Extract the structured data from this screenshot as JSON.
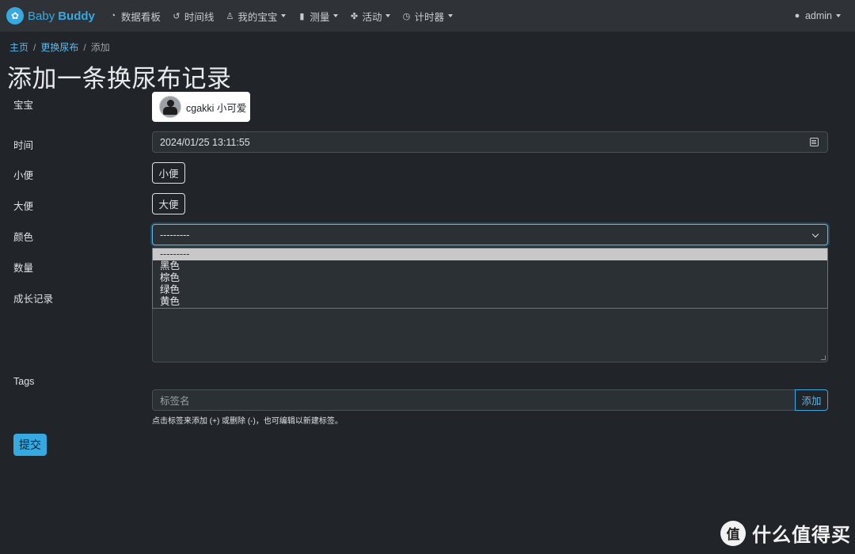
{
  "navbar": {
    "brand_prefix": "Baby",
    "brand_suffix": "Buddy",
    "items": [
      {
        "label": "数据看板",
        "icon": "dashboard-icon",
        "dropdown": false
      },
      {
        "label": "时间线",
        "icon": "history-icon",
        "dropdown": false
      },
      {
        "label": "我的宝宝",
        "icon": "baby-icon",
        "dropdown": true
      },
      {
        "label": "测量",
        "icon": "clipboard-icon",
        "dropdown": true
      },
      {
        "label": "活动",
        "icon": "activities-icon",
        "dropdown": true
      },
      {
        "label": "计时器",
        "icon": "timer-icon",
        "dropdown": true
      }
    ],
    "user": "admin"
  },
  "breadcrumb": {
    "home": "主页",
    "section": "更换尿布",
    "current": "添加"
  },
  "page_title": "添加一条换尿布记录",
  "form": {
    "child_label": "宝宝",
    "child_name": "cgakki 小可爱",
    "time_label": "时间",
    "time_value": "2024/01/25 13:11:55",
    "wet_label": "小便",
    "wet_button": "小便",
    "solid_label": "大便",
    "solid_button": "大便",
    "color_label": "颜色",
    "color_selected": "---------",
    "color_options": [
      "---------",
      "黑色",
      "棕色",
      "绿色",
      "黄色"
    ],
    "amount_label": "数量",
    "notes_label": "成长记录",
    "tags_label": "Tags",
    "tags_placeholder": "标签名",
    "tags_add": "添加",
    "tags_help": "点击标签来添加 (+) 或删除 (-)，也可编辑以新建标签。",
    "submit": "提交"
  },
  "watermark": {
    "circle": "值",
    "text": "什么值得买"
  },
  "colors": {
    "accent": "#37a9e1",
    "background": "#212429",
    "navbar": "#2f3237"
  }
}
